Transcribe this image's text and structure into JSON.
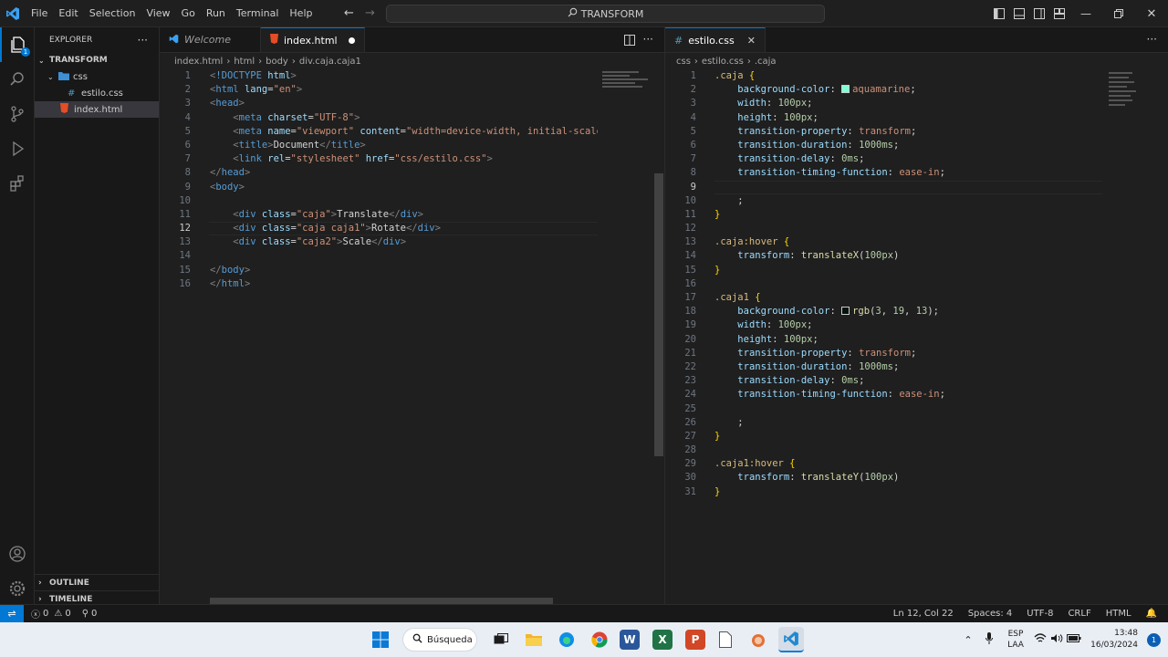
{
  "menu": [
    "File",
    "Edit",
    "Selection",
    "View",
    "Go",
    "Run",
    "Terminal",
    "Help"
  ],
  "search": {
    "label": "TRANSFORM"
  },
  "sidebar": {
    "title": "EXPLORER",
    "root": "TRANSFORM",
    "items": [
      {
        "label": "css"
      },
      {
        "label": "estilo.css"
      },
      {
        "label": "index.html"
      }
    ],
    "outline": "OUTLINE",
    "timeline": "TIMELINE"
  },
  "editor1": {
    "tabs": [
      {
        "label": "Welcome"
      },
      {
        "label": "index.html"
      }
    ],
    "breadcrumb": [
      "index.html",
      "html",
      "body",
      "div.caja.caja1"
    ],
    "lines": [
      [
        [
          "t-gray",
          "<"
        ],
        [
          "t-tag",
          "!DOCTYPE"
        ],
        [
          "t-attr",
          " html"
        ],
        [
          "t-gray",
          ">"
        ]
      ],
      [
        [
          "t-gray",
          "<"
        ],
        [
          "t-tag",
          "html"
        ],
        [
          "t-attr",
          " lang"
        ],
        [
          "t-txt",
          "="
        ],
        [
          "t-str",
          "\"en\""
        ],
        [
          "t-gray",
          ">"
        ]
      ],
      [
        [
          "t-gray",
          "<"
        ],
        [
          "t-tag",
          "head"
        ],
        [
          "t-gray",
          ">"
        ]
      ],
      [
        [
          "t-txt",
          "    "
        ],
        [
          "t-gray",
          "<"
        ],
        [
          "t-tag",
          "meta"
        ],
        [
          "t-attr",
          " charset"
        ],
        [
          "t-txt",
          "="
        ],
        [
          "t-str",
          "\"UTF-8\""
        ],
        [
          "t-gray",
          ">"
        ]
      ],
      [
        [
          "t-txt",
          "    "
        ],
        [
          "t-gray",
          "<"
        ],
        [
          "t-tag",
          "meta"
        ],
        [
          "t-attr",
          " name"
        ],
        [
          "t-txt",
          "="
        ],
        [
          "t-str",
          "\"viewport\""
        ],
        [
          "t-attr",
          " content"
        ],
        [
          "t-txt",
          "="
        ],
        [
          "t-str",
          "\"width=device-width, initial-scale="
        ]
      ],
      [
        [
          "t-txt",
          "    "
        ],
        [
          "t-gray",
          "<"
        ],
        [
          "t-tag",
          "title"
        ],
        [
          "t-gray",
          ">"
        ],
        [
          "t-txt",
          "Document"
        ],
        [
          "t-gray",
          "</"
        ],
        [
          "t-tag",
          "title"
        ],
        [
          "t-gray",
          ">"
        ]
      ],
      [
        [
          "t-txt",
          "    "
        ],
        [
          "t-gray",
          "<"
        ],
        [
          "t-tag",
          "link"
        ],
        [
          "t-attr",
          " rel"
        ],
        [
          "t-txt",
          "="
        ],
        [
          "t-str",
          "\"stylesheet\""
        ],
        [
          "t-attr",
          " href"
        ],
        [
          "t-txt",
          "="
        ],
        [
          "t-str",
          "\"css/estilo.css\""
        ],
        [
          "t-gray",
          ">"
        ]
      ],
      [
        [
          "t-gray",
          "</"
        ],
        [
          "t-tag",
          "head"
        ],
        [
          "t-gray",
          ">"
        ]
      ],
      [
        [
          "t-gray",
          "<"
        ],
        [
          "t-tag",
          "body"
        ],
        [
          "t-gray",
          ">"
        ]
      ],
      [],
      [
        [
          "t-txt",
          "    "
        ],
        [
          "t-gray",
          "<"
        ],
        [
          "t-tag",
          "div"
        ],
        [
          "t-attr",
          " class"
        ],
        [
          "t-txt",
          "="
        ],
        [
          "t-str",
          "\"caja\""
        ],
        [
          "t-gray",
          ">"
        ],
        [
          "t-txt",
          "Translate"
        ],
        [
          "t-gray",
          "</"
        ],
        [
          "t-tag",
          "div"
        ],
        [
          "t-gray",
          ">"
        ]
      ],
      [
        [
          "t-txt",
          "    "
        ],
        [
          "t-gray",
          "<"
        ],
        [
          "t-tag",
          "div"
        ],
        [
          "t-attr",
          " class"
        ],
        [
          "t-txt",
          "="
        ],
        [
          "t-str",
          "\"caja caja1\""
        ],
        [
          "t-gray",
          ">"
        ],
        [
          "t-txt",
          "Rotate"
        ],
        [
          "t-gray",
          "</"
        ],
        [
          "t-tag",
          "div"
        ],
        [
          "t-gray",
          ">"
        ]
      ],
      [
        [
          "t-txt",
          "    "
        ],
        [
          "t-gray",
          "<"
        ],
        [
          "t-tag",
          "div"
        ],
        [
          "t-attr",
          " class"
        ],
        [
          "t-txt",
          "="
        ],
        [
          "t-str",
          "\"caja2\""
        ],
        [
          "t-gray",
          ">"
        ],
        [
          "t-txt",
          "Scale"
        ],
        [
          "t-gray",
          "</"
        ],
        [
          "t-tag",
          "div"
        ],
        [
          "t-gray",
          ">"
        ]
      ],
      [],
      [
        [
          "t-gray",
          "</"
        ],
        [
          "t-tag",
          "body"
        ],
        [
          "t-gray",
          ">"
        ]
      ],
      [
        [
          "t-gray",
          "</"
        ],
        [
          "t-tag",
          "html"
        ],
        [
          "t-gray",
          ">"
        ]
      ]
    ]
  },
  "editor2": {
    "tabs": [
      {
        "label": "estilo.css"
      }
    ],
    "breadcrumb": [
      "css",
      "estilo.css",
      ".caja"
    ],
    "lines": [
      [
        [
          "t-sel",
          ".caja"
        ],
        [
          "t-brace",
          " {"
        ]
      ],
      [
        [
          "t-txt",
          "    "
        ],
        [
          "t-prop",
          "background-color"
        ],
        [
          "t-txt",
          ": "
        ],
        [
          "swatch",
          "#7fffd4"
        ],
        [
          "t-val",
          "aquamarine"
        ],
        [
          "t-txt",
          ";"
        ]
      ],
      [
        [
          "t-txt",
          "    "
        ],
        [
          "t-prop",
          "width"
        ],
        [
          "t-txt",
          ": "
        ],
        [
          "t-num",
          "100px"
        ],
        [
          "t-txt",
          ";"
        ]
      ],
      [
        [
          "t-txt",
          "    "
        ],
        [
          "t-prop",
          "height"
        ],
        [
          "t-txt",
          ": "
        ],
        [
          "t-num",
          "100px"
        ],
        [
          "t-txt",
          ";"
        ]
      ],
      [
        [
          "t-txt",
          "    "
        ],
        [
          "t-prop",
          "transition-property"
        ],
        [
          "t-txt",
          ": "
        ],
        [
          "t-val",
          "transform"
        ],
        [
          "t-txt",
          ";"
        ]
      ],
      [
        [
          "t-txt",
          "    "
        ],
        [
          "t-prop",
          "transition-duration"
        ],
        [
          "t-txt",
          ": "
        ],
        [
          "t-num",
          "1000ms"
        ],
        [
          "t-txt",
          ";"
        ]
      ],
      [
        [
          "t-txt",
          "    "
        ],
        [
          "t-prop",
          "transition-delay"
        ],
        [
          "t-txt",
          ": "
        ],
        [
          "t-num",
          "0ms"
        ],
        [
          "t-txt",
          ";"
        ]
      ],
      [
        [
          "t-txt",
          "    "
        ],
        [
          "t-prop",
          "transition-timing-function"
        ],
        [
          "t-txt",
          ": "
        ],
        [
          "t-val",
          "ease-in"
        ],
        [
          "t-txt",
          ";"
        ]
      ],
      [],
      [
        [
          "t-txt",
          "    ;"
        ]
      ],
      [
        [
          "t-brace",
          "}"
        ]
      ],
      [],
      [
        [
          "t-sel",
          ".caja:hover"
        ],
        [
          "t-brace",
          " {"
        ]
      ],
      [
        [
          "t-txt",
          "    "
        ],
        [
          "t-prop",
          "transform"
        ],
        [
          "t-txt",
          ": "
        ],
        [
          "t-fn",
          "translateX"
        ],
        [
          "t-txt",
          "("
        ],
        [
          "t-num",
          "100px"
        ],
        [
          "t-txt",
          ")"
        ]
      ],
      [
        [
          "t-brace",
          "}"
        ]
      ],
      [],
      [
        [
          "t-sel",
          ".caja1"
        ],
        [
          "t-brace",
          " {"
        ]
      ],
      [
        [
          "t-txt",
          "    "
        ],
        [
          "t-prop",
          "background-color"
        ],
        [
          "t-txt",
          ": "
        ],
        [
          "swatch",
          "#03130d"
        ],
        [
          "t-fn",
          "rgb"
        ],
        [
          "t-txt",
          "("
        ],
        [
          "t-num",
          "3"
        ],
        [
          "t-txt",
          ", "
        ],
        [
          "t-num",
          "19"
        ],
        [
          "t-txt",
          ", "
        ],
        [
          "t-num",
          "13"
        ],
        [
          "t-txt",
          ");"
        ]
      ],
      [
        [
          "t-txt",
          "    "
        ],
        [
          "t-prop",
          "width"
        ],
        [
          "t-txt",
          ": "
        ],
        [
          "t-num",
          "100px"
        ],
        [
          "t-txt",
          ";"
        ]
      ],
      [
        [
          "t-txt",
          "    "
        ],
        [
          "t-prop",
          "height"
        ],
        [
          "t-txt",
          ": "
        ],
        [
          "t-num",
          "100px"
        ],
        [
          "t-txt",
          ";"
        ]
      ],
      [
        [
          "t-txt",
          "    "
        ],
        [
          "t-prop",
          "transition-property"
        ],
        [
          "t-txt",
          ": "
        ],
        [
          "t-val",
          "transform"
        ],
        [
          "t-txt",
          ";"
        ]
      ],
      [
        [
          "t-txt",
          "    "
        ],
        [
          "t-prop",
          "transition-duration"
        ],
        [
          "t-txt",
          ": "
        ],
        [
          "t-num",
          "1000ms"
        ],
        [
          "t-txt",
          ";"
        ]
      ],
      [
        [
          "t-txt",
          "    "
        ],
        [
          "t-prop",
          "transition-delay"
        ],
        [
          "t-txt",
          ": "
        ],
        [
          "t-num",
          "0ms"
        ],
        [
          "t-txt",
          ";"
        ]
      ],
      [
        [
          "t-txt",
          "    "
        ],
        [
          "t-prop",
          "transition-timing-function"
        ],
        [
          "t-txt",
          ": "
        ],
        [
          "t-val",
          "ease-in"
        ],
        [
          "t-txt",
          ";"
        ]
      ],
      [],
      [
        [
          "t-txt",
          "    ;"
        ]
      ],
      [
        [
          "t-brace",
          "}"
        ]
      ],
      [],
      [
        [
          "t-sel",
          ".caja1:hover"
        ],
        [
          "t-brace",
          " {"
        ]
      ],
      [
        [
          "t-txt",
          "    "
        ],
        [
          "t-prop",
          "transform"
        ],
        [
          "t-txt",
          ": "
        ],
        [
          "t-fn",
          "translateY"
        ],
        [
          "t-txt",
          "("
        ],
        [
          "t-num",
          "100px"
        ],
        [
          "t-txt",
          ")"
        ]
      ],
      [
        [
          "t-brace",
          "}"
        ]
      ]
    ]
  },
  "status": {
    "errors": "0",
    "warnings": "0",
    "ports": "0",
    "position": "Ln 12, Col 22",
    "spaces": "Spaces: 4",
    "encoding": "UTF-8",
    "eol": "CRLF",
    "language": "HTML"
  },
  "taskbar": {
    "search": "Búsqueda",
    "lang1": "ESP",
    "lang2": "LAA",
    "time": "13:48",
    "date": "16/03/2024",
    "notif": "1"
  },
  "colors": {
    "accent": "#0078d4",
    "statusblue": "#0078d4"
  }
}
